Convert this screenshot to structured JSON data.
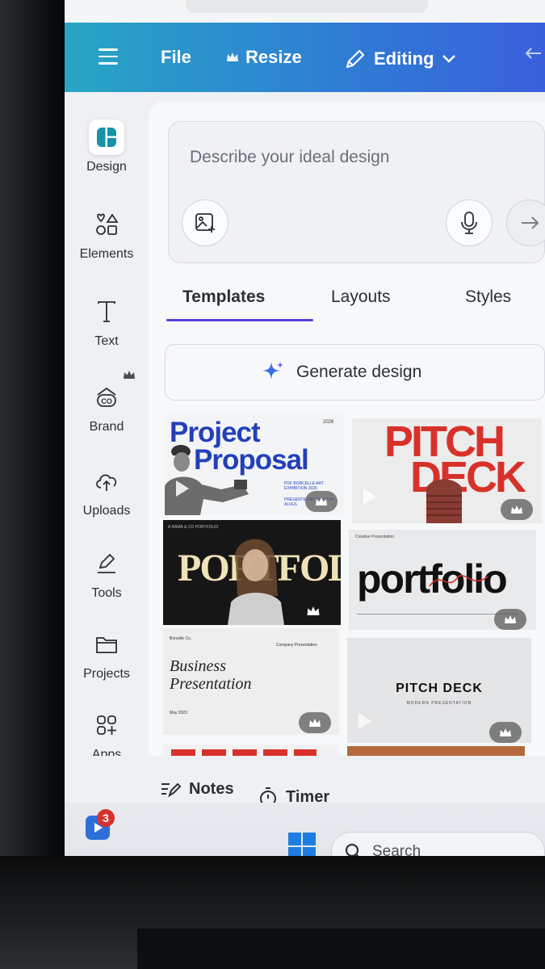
{
  "header": {
    "file_label": "File",
    "resize_label": "Resize",
    "editing_label": "Editing"
  },
  "sidebar": {
    "items": [
      {
        "label": "Design",
        "icon": "design-icon"
      },
      {
        "label": "Elements",
        "icon": "shapes-icon"
      },
      {
        "label": "Text",
        "icon": "text-icon"
      },
      {
        "label": "Brand",
        "icon": "brand-icon"
      },
      {
        "label": "Uploads",
        "icon": "cloud-upload-icon"
      },
      {
        "label": "Tools",
        "icon": "pen-tool-icon"
      },
      {
        "label": "Projects",
        "icon": "folder-icon"
      },
      {
        "label": "Apps",
        "icon": "apps-grid-icon"
      }
    ]
  },
  "prompt": {
    "placeholder": "Describe your ideal design"
  },
  "tabs": [
    {
      "label": "Templates",
      "active": true
    },
    {
      "label": "Layouts",
      "active": false
    },
    {
      "label": "Styles",
      "active": false
    }
  ],
  "generate_button": {
    "label": "Generate design"
  },
  "templates": [
    {
      "line1": "Project",
      "line2": "Proposal",
      "small": "PDF BORCELLE ART EXHIBITION 2026",
      "small2": "PRESENTED BY CLAUDIA ALVES",
      "year": "2026"
    },
    {
      "line1": "PITCH",
      "line2": "DECK"
    },
    {
      "title": "PORTFOLIO",
      "top_label": "A RAMA & CO PORTFOLIO"
    },
    {
      "title": "portfolio",
      "top_label": "Creative Presentation"
    },
    {
      "line1": "Business",
      "line2": "Presentation",
      "top_left": "Borcelle Co.",
      "top_right": "Company Presentation",
      "date": "May 2023"
    },
    {
      "title": "PITCH DECK",
      "subtitle": "MODERN PRESENTATION"
    }
  ],
  "bottombar": {
    "notes_label": "Notes",
    "timer_label": "Timer"
  },
  "taskbar": {
    "search_label": "Search",
    "badge_count": "3"
  },
  "colors": {
    "header_start": "#27a6c4",
    "header_end": "#3a5fdc",
    "tab_accent": "#5b3fe0",
    "pitch_red": "#d8312a"
  }
}
